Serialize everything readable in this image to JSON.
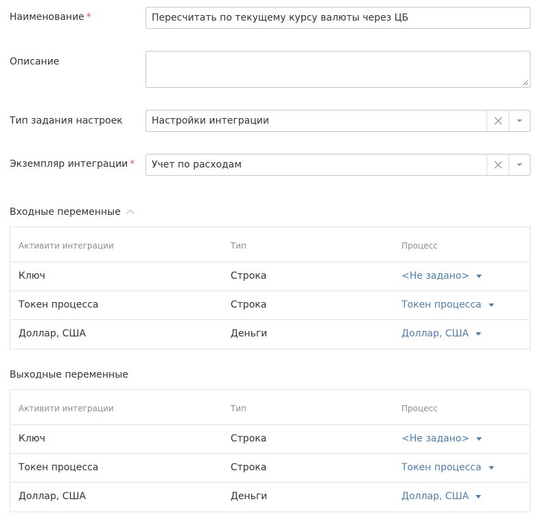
{
  "form": {
    "name": {
      "label": "Наименование",
      "required": "*",
      "value": "Пересчитать по текущему курсу валюты через ЦБ"
    },
    "description": {
      "label": "Описание",
      "value": ""
    },
    "task_type": {
      "label": "Тип задания настроек",
      "value": "Настройки интеграции"
    },
    "integration_instance": {
      "label": "Экземпляр интеграции",
      "required": "*",
      "value": "Учет по расходам"
    }
  },
  "input_vars": {
    "title": "Входные переменные",
    "headers": [
      "Активити интеграции",
      "Тип",
      "Процесс"
    ],
    "rows": [
      {
        "activity": "Ключ",
        "type": "Строка",
        "process": "<Не задано>"
      },
      {
        "activity": "Токен процесса",
        "type": "Строка",
        "process": "Токен процесса"
      },
      {
        "activity": "Доллар, США",
        "type": "Деньги",
        "process": "Доллар, США"
      }
    ]
  },
  "output_vars": {
    "title": "Выходные переменные",
    "headers": [
      "Активити интеграции",
      "Тип",
      "Процесс"
    ],
    "rows": [
      {
        "activity": "Ключ",
        "type": "Строка",
        "process": "<Не задано>"
      },
      {
        "activity": "Токен процесса",
        "type": "Строка",
        "process": "Токен процесса"
      },
      {
        "activity": "Доллар, США",
        "type": "Деньги",
        "process": "Доллар, США"
      }
    ]
  },
  "icons": {
    "clear": "close-icon",
    "dropdown": "chevron-down-icon",
    "collapse": "chevron-up-icon",
    "resize": "resize-handle-icon"
  },
  "colors": {
    "required": "#d9534f",
    "link": "#4a7fb5",
    "border": "#c8c8c8"
  }
}
